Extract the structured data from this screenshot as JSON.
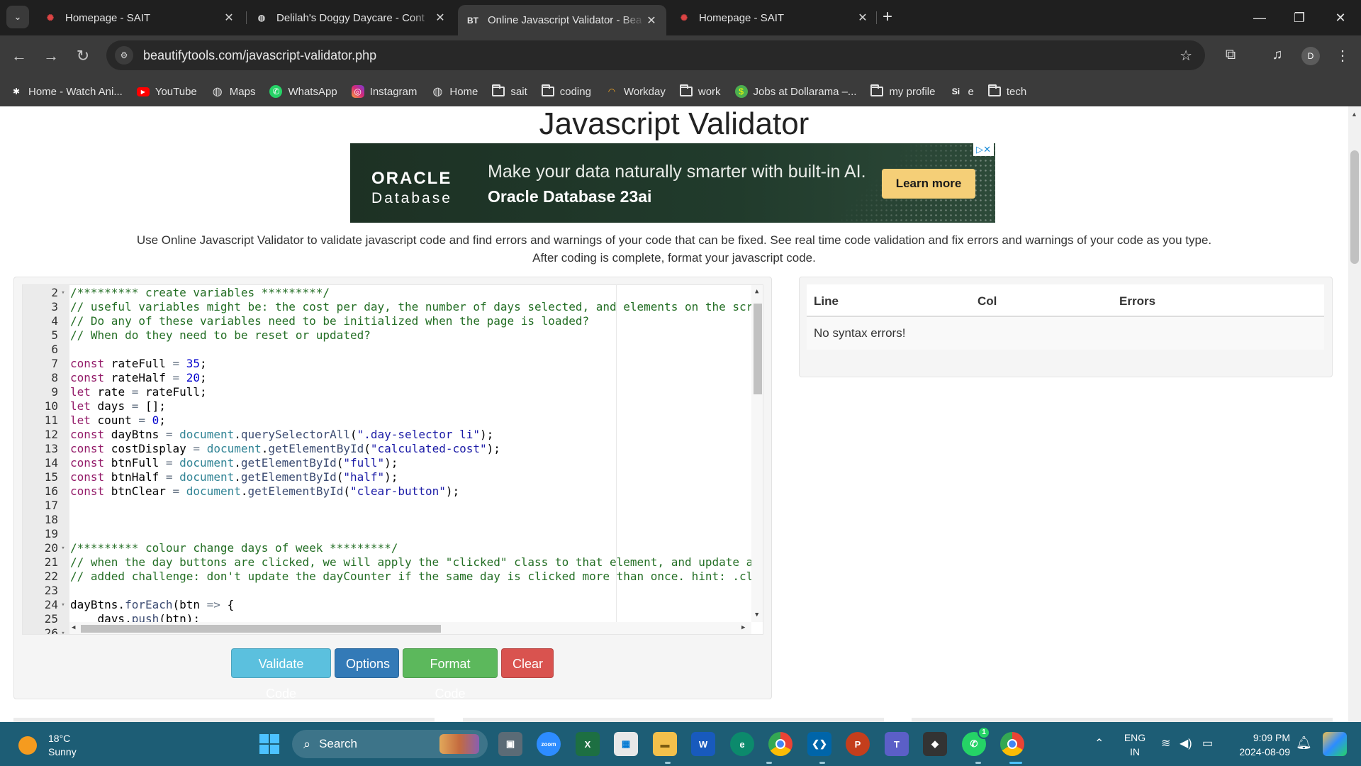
{
  "browser": {
    "tabs": [
      {
        "title": "Homepage - SAIT",
        "favicon": "sait-icon"
      },
      {
        "title": "Delilah's Doggy Daycare - Cont",
        "favicon": "globe-icon"
      },
      {
        "title": "Online Javascript Validator - Bea",
        "favicon": "BT"
      },
      {
        "title": "Homepage - SAIT",
        "favicon": "sait-icon"
      }
    ],
    "active_tab": 2,
    "url": "beautifytools.com/javascript-validator.php",
    "profile_initial": "D",
    "bookmarks": [
      {
        "label": "Home - Watch Ani...",
        "icon": "anime-icon"
      },
      {
        "label": "YouTube",
        "icon": "youtube-icon"
      },
      {
        "label": "Maps",
        "icon": "globe-icon"
      },
      {
        "label": "WhatsApp",
        "icon": "whatsapp-icon"
      },
      {
        "label": "Instagram",
        "icon": "instagram-icon"
      },
      {
        "label": "Home",
        "icon": "globe-icon"
      },
      {
        "label": "sait",
        "icon": "folder-icon"
      },
      {
        "label": "coding",
        "icon": "folder-icon"
      },
      {
        "label": "Workday",
        "icon": "workday-icon"
      },
      {
        "label": "work",
        "icon": "folder-icon"
      },
      {
        "label": "Jobs at Dollarama –...",
        "icon": "dollarama-icon"
      },
      {
        "label": "my profile",
        "icon": "folder-icon"
      },
      {
        "label": "e",
        "icon": "si-icon"
      },
      {
        "label": "tech",
        "icon": "folder-icon"
      }
    ]
  },
  "page": {
    "title": "Javascript Validator",
    "ad": {
      "brand_line1": "ORACLE",
      "brand_line2": "Database",
      "headline": "Make your data naturally smarter with built-in AI.",
      "subline": "Oracle Database 23ai",
      "cta": "Learn more",
      "adchoices": "▷✕"
    },
    "intro": "Use Online Javascript Validator to validate javascript code and find errors and warnings of your code that can be fixed. See real time code validation and fix errors and warnings of your code as you type. After coding is complete, format your javascript code.",
    "buttons": {
      "validate": "Validate Code",
      "options": "Options",
      "format": "Format Code",
      "clear": "Clear"
    },
    "errors_table": {
      "columns": [
        "Line",
        "Col",
        "Errors"
      ],
      "message": "No syntax errors!"
    }
  },
  "editor": {
    "lines": [
      {
        "n": "2",
        "fold": true,
        "segs": [
          [
            "c",
            "/********* create variables *********/"
          ]
        ]
      },
      {
        "n": "3",
        "segs": [
          [
            "c",
            "// useful variables might be: the cost per day, the number of days selected, and elements on the scr"
          ]
        ]
      },
      {
        "n": "4",
        "segs": [
          [
            "c",
            "// Do any of these variables need to be initialized when the page is loaded?"
          ]
        ]
      },
      {
        "n": "5",
        "segs": [
          [
            "c",
            "// When do they need to be reset or updated?"
          ]
        ]
      },
      {
        "n": "6",
        "segs": []
      },
      {
        "n": "7",
        "segs": [
          [
            "k",
            "const"
          ],
          [
            "t",
            " rateFull "
          ],
          [
            "o",
            "="
          ],
          [
            "t",
            " "
          ],
          [
            "n",
            "35"
          ],
          [
            "t",
            ";"
          ]
        ]
      },
      {
        "n": "8",
        "segs": [
          [
            "k",
            "const"
          ],
          [
            "t",
            " rateHalf "
          ],
          [
            "o",
            "="
          ],
          [
            "t",
            " "
          ],
          [
            "n",
            "20"
          ],
          [
            "t",
            ";"
          ]
        ]
      },
      {
        "n": "9",
        "segs": [
          [
            "k",
            "let"
          ],
          [
            "t",
            " rate "
          ],
          [
            "o",
            "="
          ],
          [
            "t",
            " rateFull;"
          ]
        ]
      },
      {
        "n": "10",
        "segs": [
          [
            "k",
            "let"
          ],
          [
            "t",
            " days "
          ],
          [
            "o",
            "="
          ],
          [
            "t",
            " [];"
          ]
        ]
      },
      {
        "n": "11",
        "segs": [
          [
            "k",
            "let"
          ],
          [
            "t",
            " count "
          ],
          [
            "o",
            "="
          ],
          [
            "t",
            " "
          ],
          [
            "n",
            "0"
          ],
          [
            "t",
            ";"
          ]
        ]
      },
      {
        "n": "12",
        "segs": [
          [
            "k",
            "const"
          ],
          [
            "t",
            " dayBtns "
          ],
          [
            "o",
            "="
          ],
          [
            "t",
            " "
          ],
          [
            "b",
            "document"
          ],
          [
            "t",
            "."
          ],
          [
            "f",
            "querySelectorAll"
          ],
          [
            "t",
            "("
          ],
          [
            "s",
            "\".day-selector li\""
          ],
          [
            "t",
            ");"
          ]
        ]
      },
      {
        "n": "13",
        "segs": [
          [
            "k",
            "const"
          ],
          [
            "t",
            " costDisplay "
          ],
          [
            "o",
            "="
          ],
          [
            "t",
            " "
          ],
          [
            "b",
            "document"
          ],
          [
            "t",
            "."
          ],
          [
            "f",
            "getElementById"
          ],
          [
            "t",
            "("
          ],
          [
            "s",
            "\"calculated-cost\""
          ],
          [
            "t",
            ");"
          ]
        ]
      },
      {
        "n": "14",
        "segs": [
          [
            "k",
            "const"
          ],
          [
            "t",
            " btnFull "
          ],
          [
            "o",
            "="
          ],
          [
            "t",
            " "
          ],
          [
            "b",
            "document"
          ],
          [
            "t",
            "."
          ],
          [
            "f",
            "getElementById"
          ],
          [
            "t",
            "("
          ],
          [
            "s",
            "\"full\""
          ],
          [
            "t",
            ");"
          ]
        ]
      },
      {
        "n": "15",
        "segs": [
          [
            "k",
            "const"
          ],
          [
            "t",
            " btnHalf "
          ],
          [
            "o",
            "="
          ],
          [
            "t",
            " "
          ],
          [
            "b",
            "document"
          ],
          [
            "t",
            "."
          ],
          [
            "f",
            "getElementById"
          ],
          [
            "t",
            "("
          ],
          [
            "s",
            "\"half\""
          ],
          [
            "t",
            ");"
          ]
        ]
      },
      {
        "n": "16",
        "segs": [
          [
            "k",
            "const"
          ],
          [
            "t",
            " btnClear "
          ],
          [
            "o",
            "="
          ],
          [
            "t",
            " "
          ],
          [
            "b",
            "document"
          ],
          [
            "t",
            "."
          ],
          [
            "f",
            "getElementById"
          ],
          [
            "t",
            "("
          ],
          [
            "s",
            "\"clear-button\""
          ],
          [
            "t",
            ");"
          ]
        ]
      },
      {
        "n": "17",
        "segs": []
      },
      {
        "n": "18",
        "segs": []
      },
      {
        "n": "19",
        "segs": []
      },
      {
        "n": "20",
        "fold": true,
        "segs": [
          [
            "c",
            "/********* colour change days of week *********/"
          ]
        ]
      },
      {
        "n": "21",
        "segs": [
          [
            "c",
            "// when the day buttons are clicked, we will apply the \"clicked\" class to that element, and update a"
          ]
        ]
      },
      {
        "n": "22",
        "segs": [
          [
            "c",
            "// added challenge: don't update the dayCounter if the same day is clicked more than once. hint: .cl"
          ]
        ]
      },
      {
        "n": "23",
        "segs": []
      },
      {
        "n": "24",
        "fold": true,
        "segs": [
          [
            "t",
            "dayBtns."
          ],
          [
            "f",
            "forEach"
          ],
          [
            "t",
            "(btn "
          ],
          [
            "o",
            "=>"
          ],
          [
            "t",
            " {"
          ]
        ]
      },
      {
        "n": "25",
        "segs": [
          [
            "t",
            "    days."
          ],
          [
            "f",
            "push"
          ],
          [
            "t",
            "(btn);"
          ]
        ]
      },
      {
        "n": "26",
        "fold": true,
        "segs": []
      }
    ]
  },
  "taskbar": {
    "temperature": "18°C",
    "weather": "Sunny",
    "search_placeholder": "Search",
    "apps": [
      "file-explorer-widget-icon",
      "task-view-icon",
      "zoom-icon",
      "excel-icon",
      "microsoft-store-icon",
      "folder-icon",
      "word-icon",
      "edge-icon",
      "chrome-icon",
      "vscode-icon",
      "powerpoint-icon",
      "teams-icon",
      "unity-icon",
      "whatsapp-icon",
      "chrome-profile-icon"
    ],
    "whatsapp_badge": "1",
    "language": "ENG",
    "region": "IN",
    "time": "9:09 PM",
    "date": "2024-08-09"
  },
  "colors": {
    "chrome_dark": "#1f1f1f",
    "chrome_toolbar": "#3b3b3b",
    "btn_validate": "#5bc0de",
    "btn_options": "#337ab7",
    "btn_format": "#5cb85c",
    "btn_clear": "#d9534f",
    "taskbar": "#1d5d75"
  }
}
